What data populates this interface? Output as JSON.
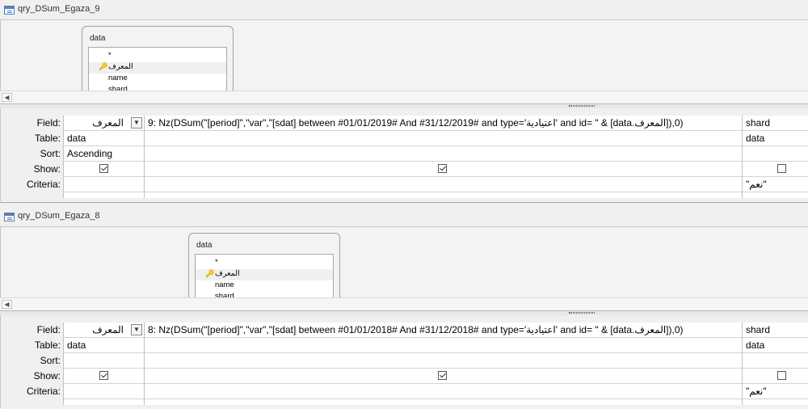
{
  "queries": [
    {
      "title": "qry_DSum_Egaza_9",
      "table": {
        "name": "data",
        "fields": [
          "*",
          "المعرف",
          "name",
          "shard"
        ]
      },
      "grid": {
        "row_labels": {
          "field": "Field:",
          "table": "Table:",
          "sort": "Sort:",
          "show": "Show:",
          "criteria": "Criteria:"
        },
        "columns": [
          {
            "field": "المعرف",
            "table": "data",
            "sort": "Ascending",
            "show": true,
            "criteria": ""
          },
          {
            "field": "9: Nz(DSum(\"[period]\",\"var\",\"[sdat] between #01/01/2019# And #31/12/2019# and type='اعتيادية' and id= \" & [data.المعرف]),0)",
            "table": "",
            "sort": "",
            "show": true,
            "criteria": ""
          },
          {
            "field": "shard",
            "table": "data",
            "sort": "",
            "show": false,
            "criteria": "\"نعم\""
          }
        ]
      }
    },
    {
      "title": "qry_DSum_Egaza_8",
      "table": {
        "name": "data",
        "fields": [
          "*",
          "المعرف",
          "name",
          "shard"
        ]
      },
      "grid": {
        "row_labels": {
          "field": "Field:",
          "table": "Table:",
          "sort": "Sort:",
          "show": "Show:",
          "criteria": "Criteria:"
        },
        "columns": [
          {
            "field": "المعرف",
            "table": "data",
            "sort": "",
            "show": true,
            "criteria": ""
          },
          {
            "field": "8: Nz(DSum(\"[period]\",\"var\",\"[sdat] between #01/01/2018# And #31/12/2018# and type='اعتيادية' and id= \" & [data.المعرف]),0)",
            "table": "",
            "sort": "",
            "show": true,
            "criteria": ""
          },
          {
            "field": "shard",
            "table": "data",
            "sort": "",
            "show": false,
            "criteria": "\"نعم\""
          }
        ]
      }
    }
  ],
  "icons": {
    "query_icon": "query-design-icon",
    "key_icon": "primary-key-icon",
    "scroll_left": "scroll-left-arrow-icon",
    "dropdown": "chevron-down-icon"
  }
}
